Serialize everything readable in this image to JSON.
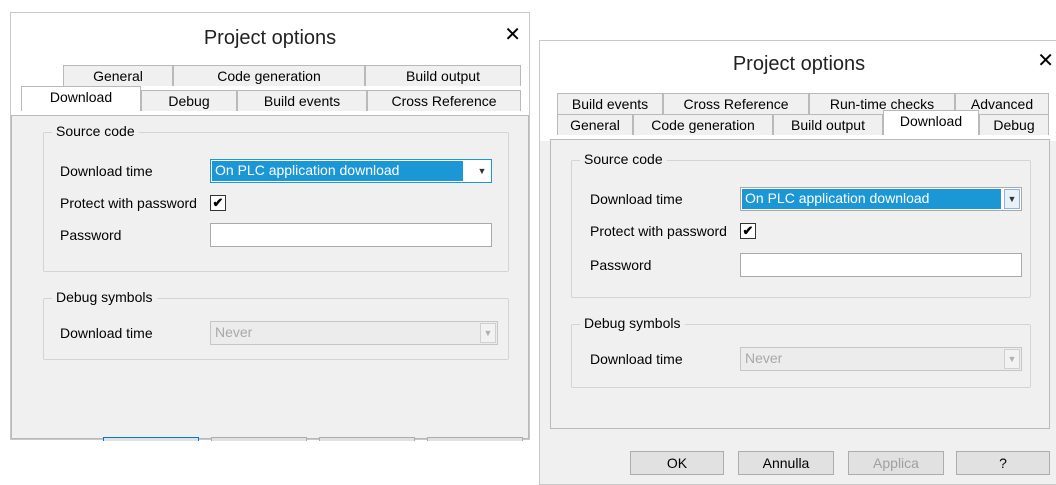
{
  "dialog_left": {
    "title": "Project options",
    "tabs_back": [
      "General",
      "Code generation",
      "Build output"
    ],
    "tabs_front": [
      "Download",
      "Debug",
      "Build events",
      "Cross Reference"
    ],
    "source_code": {
      "legend": "Source code",
      "download_time_label": "Download time",
      "download_time_value": "On PLC application download",
      "protect_label": "Protect with password",
      "protect_checked": "✔",
      "password_label": "Password"
    },
    "debug_symbols": {
      "legend": "Debug symbols",
      "download_time_label": "Download time",
      "download_time_value": "Never"
    }
  },
  "dialog_right": {
    "title": "Project options",
    "tabs_back": [
      "Build events",
      "Cross Reference",
      "Run-time checks",
      "Advanced"
    ],
    "tabs_front": [
      "General",
      "Code generation",
      "Build output",
      "Download",
      "Debug"
    ],
    "source_code": {
      "legend": "Source code",
      "download_time_label": "Download time",
      "download_time_value": "On PLC application download",
      "protect_label": "Protect with password",
      "protect_checked": "✔",
      "password_label": "Password"
    },
    "debug_symbols": {
      "legend": "Debug symbols",
      "download_time_label": "Download time",
      "download_time_value": "Never"
    },
    "buttons": {
      "ok": "OK",
      "cancel": "Annulla",
      "apply": "Applica",
      "help": "?"
    }
  },
  "icons": {
    "close": "close-icon",
    "dropdown": "chevron-down-icon",
    "check": "checkmark-icon"
  },
  "colors": {
    "selection": "#1b97d6",
    "dialog_bg": "#f0f0f0",
    "titlebar_bg": "#ffffff"
  }
}
